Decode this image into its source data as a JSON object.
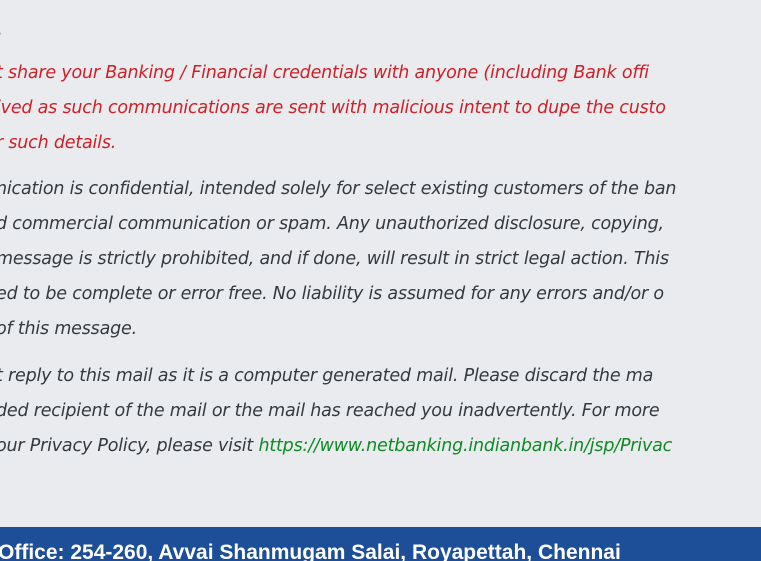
{
  "notice_heading": ":",
  "warning_lines": [
    "t share your Banking / Financial credentials with anyone (including Bank offi",
    "ived as such communications are sent with malicious intent to dupe the custo",
    "r such details."
  ],
  "confidential_lines": [
    "nication is confidential, intended solely for select  existing customers of the ban",
    "d commercial communication or spam. Any unauthorized disclosure, copying,",
    "message is strictly prohibited, and if done, will result in strict legal action. This",
    "ed to be complete or error free. No liability is assumed for any errors and/or o",
    "of this message."
  ],
  "reply_lines": [
    "t reply to this mail as it is a computer generated mail. Please discard the ma",
    "ded recipient of the mail or the mail has reached you inadvertently. For more"
  ],
  "privacy_prefix": "our Privacy Policy, please visit ",
  "privacy_link": "https://www.netbanking.indianbank.in/jsp/Privac",
  "footer_address": "Office: 254-260, Avvai Shanmugam Salai, Royapettah, Chennai"
}
